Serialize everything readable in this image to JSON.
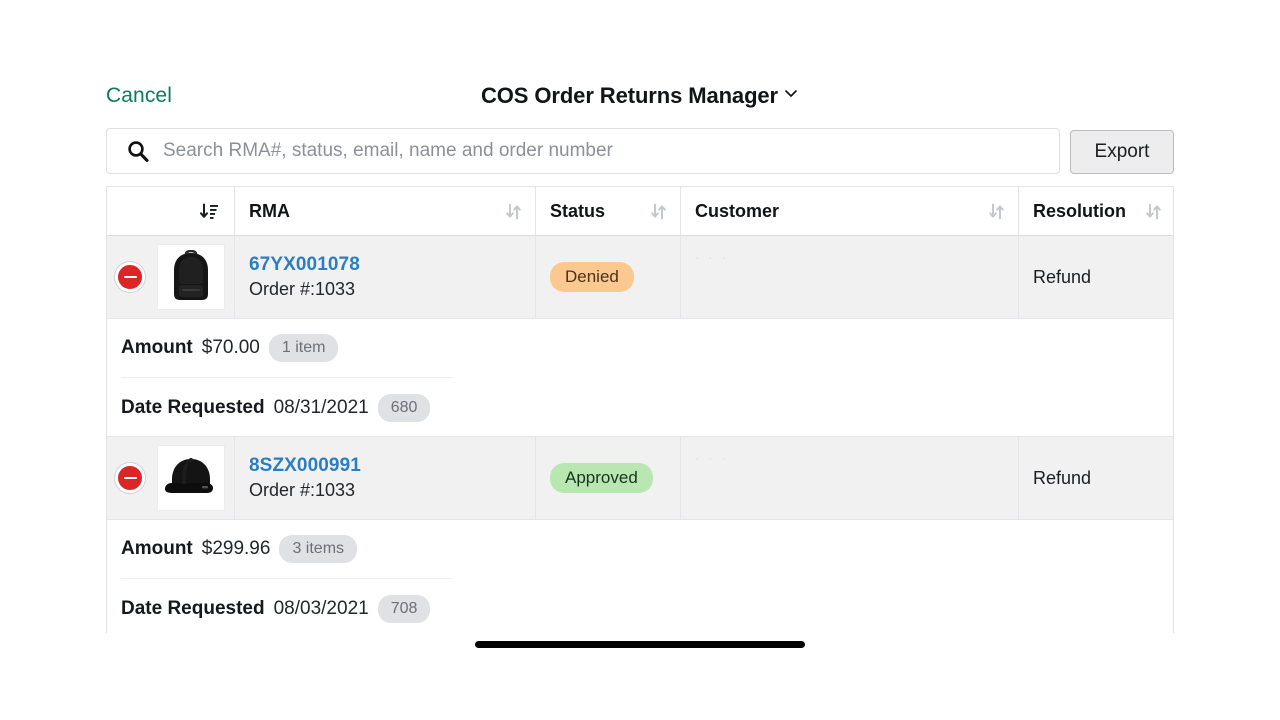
{
  "header": {
    "cancel_label": "Cancel",
    "title": "COS Order Returns Manager",
    "title_chevron_icon": "chevron-down-icon"
  },
  "search": {
    "icon": "search-icon",
    "placeholder": "Search RMA#, status, email, name and order number",
    "value": ""
  },
  "toolbar": {
    "export_label": "Export"
  },
  "table": {
    "columns": [
      {
        "key": "control",
        "label": "",
        "sort_icon": "sort-descending-icon",
        "sort_active": true
      },
      {
        "key": "rma",
        "label": "RMA",
        "sort_icon": "sort-both-icon",
        "sort_active": false
      },
      {
        "key": "status",
        "label": "Status",
        "sort_icon": "sort-both-icon",
        "sort_active": false
      },
      {
        "key": "customer",
        "label": "Customer",
        "sort_icon": "sort-both-icon",
        "sort_active": false
      },
      {
        "key": "resolution",
        "label": "Resolution",
        "sort_icon": "sort-both-icon",
        "sort_active": false
      }
    ],
    "rows": [
      {
        "delete_icon": "minus-circle-icon",
        "thumbnail_icon": "backpack-thumbnail",
        "rma": "67YX001078",
        "order": "Order #:1033",
        "status": "Denied",
        "status_variant": "denied",
        "customer": "",
        "customer_redacted": "· · ·",
        "resolution": "Refund",
        "detail": {
          "amount_label": "Amount",
          "amount_value": "$70.00",
          "amount_pill": "1 item",
          "date_label": "Date Requested",
          "date_value": "08/31/2021",
          "date_pill": "680"
        }
      },
      {
        "delete_icon": "minus-circle-icon",
        "thumbnail_icon": "cap-thumbnail",
        "rma": "8SZX000991",
        "order": "Order #:1033",
        "status": "Approved",
        "status_variant": "approved",
        "customer": "",
        "customer_redacted": "· · ·",
        "resolution": "Refund",
        "detail": {
          "amount_label": "Amount",
          "amount_value": "$299.96",
          "amount_pill": "3 items",
          "date_label": "Date Requested",
          "date_value": "08/03/2021",
          "date_pill": "708"
        }
      }
    ]
  },
  "colors": {
    "cancel_green": "#0b7a5d",
    "rma_link_blue": "#2b7ec1",
    "badge_denied_bg": "#fbc88f",
    "badge_approved_bg": "#b9e7b1",
    "delete_red": "#dc2626",
    "row_bg": "#f1f1f2"
  },
  "system": {
    "home_indicator": "home-indicator"
  }
}
